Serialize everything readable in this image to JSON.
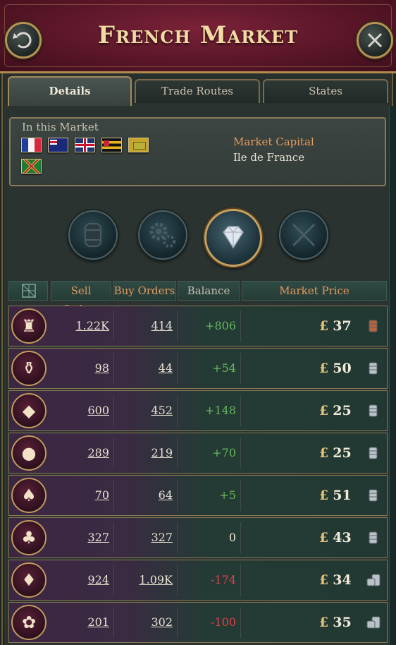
{
  "header": {
    "title": "French Market"
  },
  "tabs": [
    {
      "label": "Details",
      "active": true
    },
    {
      "label": "Trade Routes",
      "active": false
    },
    {
      "label": "States",
      "active": false
    }
  ],
  "members": {
    "label": "In this Market",
    "capital_label": "Market Capital",
    "capital_value": "Ile de France"
  },
  "categories": [
    {
      "name": "barrel-icon"
    },
    {
      "name": "gears-icon"
    },
    {
      "name": "diamond-icon",
      "active": true
    },
    {
      "name": "crossed-rifles-icon"
    }
  ],
  "table": {
    "headers": {
      "sell": "Sell Orders",
      "buy": "Buy Orders",
      "balance": "Balance",
      "price": "Market Price"
    },
    "rows": [
      {
        "good": "luxury-furniture-icon",
        "sell": "1.22K",
        "buy": "414",
        "balance": "+806",
        "price": "37",
        "currency": "£",
        "coin": "copper"
      },
      {
        "good": "porcelain-icon",
        "sell": "98",
        "buy": "44",
        "balance": "+54",
        "price": "50",
        "currency": "£",
        "coin": "silver"
      },
      {
        "good": "meat-icon",
        "sell": "600",
        "buy": "452",
        "balance": "+148",
        "price": "25",
        "currency": "£",
        "coin": "silver"
      },
      {
        "good": "fruit-icon",
        "sell": "289",
        "buy": "219",
        "balance": "+70",
        "price": "25",
        "currency": "£",
        "coin": "silver"
      },
      {
        "good": "luxury-clothes-icon",
        "sell": "70",
        "buy": "64",
        "balance": "+5",
        "price": "51",
        "currency": "£",
        "coin": "silver"
      },
      {
        "good": "wine-icon",
        "sell": "327",
        "buy": "327",
        "balance": "0",
        "price": "43",
        "currency": "£",
        "coin": "silver"
      },
      {
        "good": "liquor-icon",
        "sell": "924",
        "buy": "1.09K",
        "balance": "-174",
        "price": "34",
        "currency": "£",
        "coin": "silver-stack"
      },
      {
        "good": "grain-icon",
        "sell": "201",
        "buy": "302",
        "balance": "-100",
        "price": "35",
        "currency": "£",
        "coin": "silver-stack"
      }
    ]
  },
  "colors": {
    "positive": "#68b85a",
    "negative": "#e2414a",
    "accent": "#e59a5e"
  }
}
